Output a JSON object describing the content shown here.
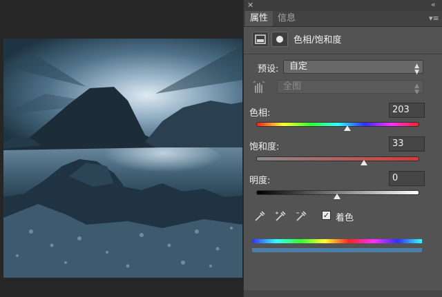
{
  "panel": {
    "tab_active": "属性",
    "tab_inactive": "信息",
    "collapse_glyph": "«",
    "close_glyph": "✕",
    "menu_glyph": "▾≡",
    "title": "色相/饱和度",
    "preset_label": "预设:",
    "preset_value": "自定",
    "channel_value": "全图",
    "hue_label": "色相:",
    "hue_value": "203",
    "saturation_label": "饱和度:",
    "saturation_value": "33",
    "lightness_label": "明度:",
    "lightness_value": "0",
    "colorize_label": "着色",
    "colorize_checked": true,
    "hue_fraction": 0.564,
    "saturation_fraction": 0.665,
    "lightness_fraction": 0.5
  },
  "colors": {
    "panel_bg": "#535353",
    "tone_color": "#4d7fa8"
  },
  "icons": {
    "close": "close-icon",
    "collapse": "collapse-icon",
    "menu": "panel-menu-icon",
    "adjustment_layer": "adjustment-layer-icon",
    "mask": "mask-icon",
    "hand_adjust": "targeted-adjustment-hand-icon",
    "eyedropper": "eyedropper-icon",
    "eyedropper_add": "eyedropper-plus-icon",
    "eyedropper_subtract": "eyedropper-minus-icon"
  }
}
